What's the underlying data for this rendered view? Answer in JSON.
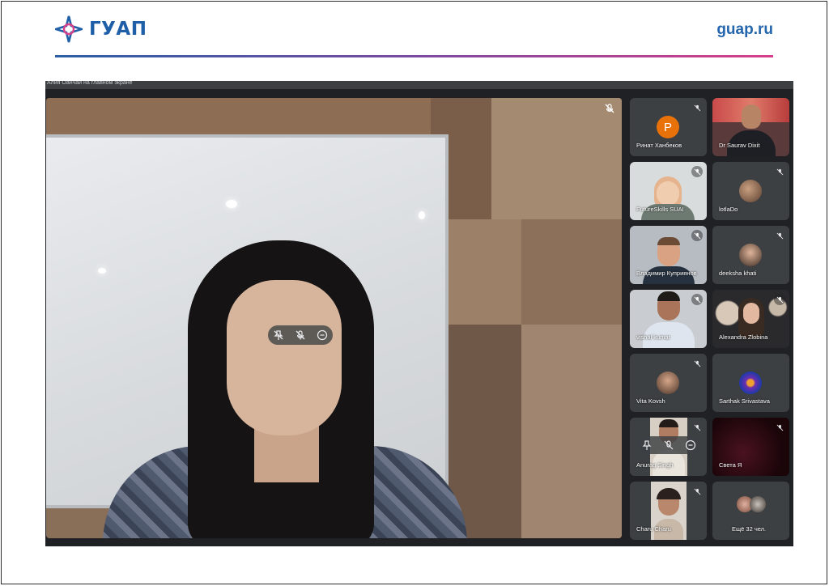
{
  "brand": {
    "logo_text": "ГУАП",
    "site_url": "guap.ru",
    "accent_colors": [
      "#2a5fa6",
      "#d63f8a"
    ]
  },
  "meeting": {
    "topbar_caption": "Алия Оанчай на главном экране",
    "main_speaker": {
      "hover_controls": [
        "pin-icon",
        "mic-off-icon",
        "more-icon"
      ],
      "mic_state": "muted"
    },
    "participants": [
      {
        "name": "Ринат Ханбеков",
        "type": "letter",
        "letter": "P",
        "color": "#e8710a",
        "mic": "muted"
      },
      {
        "name": "Dr Saurav Dixit",
        "type": "camera",
        "mic": "on"
      },
      {
        "name": "FutureSkills SUAI",
        "type": "camera",
        "mic": "muted"
      },
      {
        "name": "lotlaDo",
        "type": "photo",
        "mic": "muted"
      },
      {
        "name": "Владимир Куприянов",
        "type": "camera",
        "mic": "muted"
      },
      {
        "name": "deeksha khati",
        "type": "photo",
        "mic": "muted"
      },
      {
        "name": "vishal kumar",
        "type": "camera",
        "mic": "muted"
      },
      {
        "name": "Alexandra Zlobina",
        "type": "camera",
        "mic": "muted"
      },
      {
        "name": "Vita Kovsh",
        "type": "photo",
        "mic": "muted"
      },
      {
        "name": "Sarthak Srivastava",
        "type": "photo",
        "mic": "on"
      },
      {
        "name": "Anurag Singh",
        "type": "camera",
        "mic": "muted",
        "controls": [
          "pin-icon",
          "mic-off-icon",
          "more-icon"
        ]
      },
      {
        "name": "Света Я",
        "type": "camera",
        "mic": "muted"
      },
      {
        "name": "Charu Charu",
        "type": "camera",
        "mic": "muted"
      },
      {
        "name": "Ещё 32 чел.",
        "type": "more",
        "mic": "none"
      }
    ]
  }
}
